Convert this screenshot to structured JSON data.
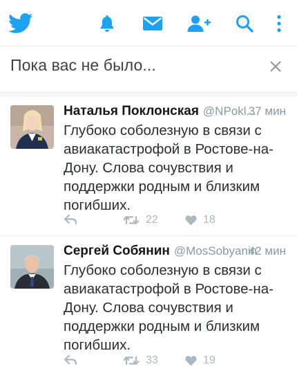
{
  "nav": {
    "icons": [
      "twitter-bird-icon",
      "bell-icon",
      "mail-icon",
      "add-user-icon",
      "search-icon",
      "more-vertical-icon"
    ],
    "accent": "#1da1f2"
  },
  "banner": {
    "title": "Пока вас не было...",
    "close_icon": "close-icon"
  },
  "tweets": [
    {
      "name": "Наталья Поклонская",
      "handle": "@NPokl...",
      "time": "37 мин",
      "text": "Глубоко соболезную в связи с авиакатастрофой в Ростове-на-Дону. Слова сочувствия и поддержки родным и близким погибших.",
      "retweets": "22",
      "likes": "18"
    },
    {
      "name": "Сергей Собянин",
      "handle": "@MosSobyanin",
      "time": "42 мин",
      "text": "Глубоко соболезную в связи с авиакатастрофой в Ростове-на-Дону. Слова сочувствия и поддержки родным и близким погибших.",
      "retweets": "33",
      "likes": "19"
    }
  ]
}
